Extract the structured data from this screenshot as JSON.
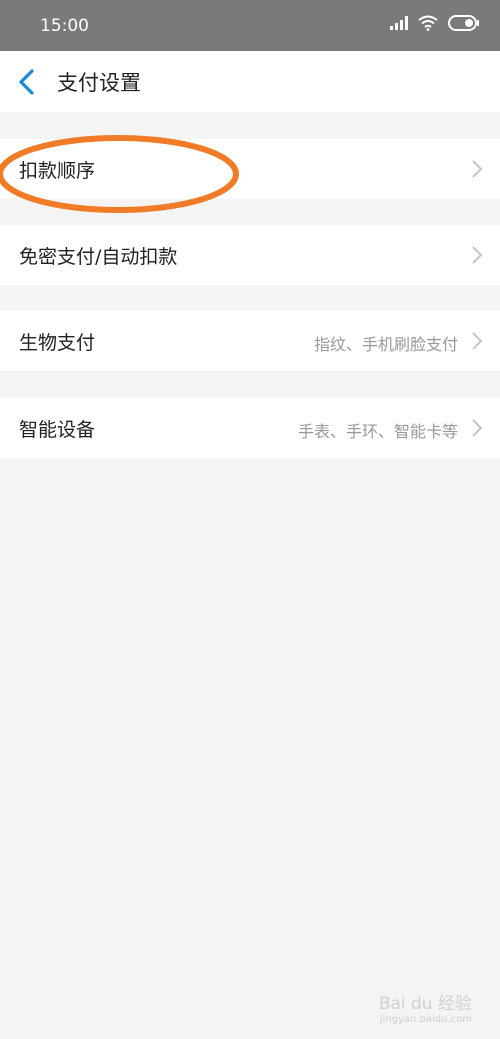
{
  "status_bar": {
    "time": "15:00",
    "icons": [
      "signal-icon",
      "wifi-icon",
      "battery-icon"
    ]
  },
  "header": {
    "title": "支付设置",
    "back_icon": "chevron-left-icon"
  },
  "settings": [
    {
      "label": "扣款顺序",
      "value": ""
    },
    {
      "label": "免密支付/自动扣款",
      "value": ""
    },
    {
      "label": "生物支付",
      "value": "指纹、手机刷脸支付"
    },
    {
      "label": "智能设备",
      "value": "手表、手环、智能卡等"
    }
  ],
  "watermark": {
    "text": "Bai du 经验",
    "sub": "jingyan.baidu.com"
  },
  "colors": {
    "status_bar": "#7a7a7a",
    "accent": "#1a8ad4",
    "annotation": "#f07c28",
    "background": "#f4f4f4"
  }
}
